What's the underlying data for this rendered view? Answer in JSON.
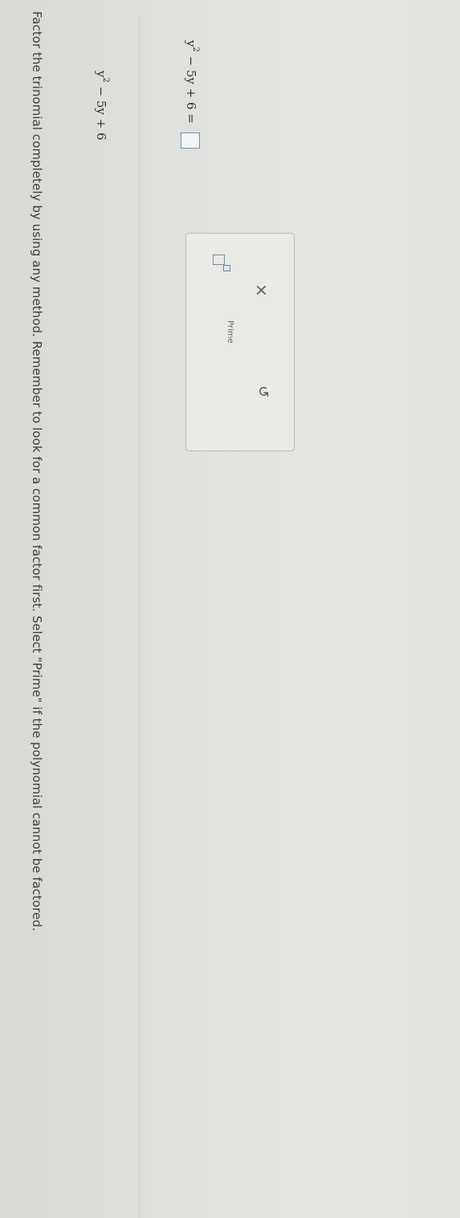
{
  "question": {
    "instructions": "Factor the trinomial completely by using any method. Remember to look for a common factor first. Select \"Prime\" if the polynomial cannot be factored.",
    "given_polynomial": {
      "base": "y",
      "exponent": "2",
      "rest": " − 5y + 6"
    },
    "answer_row": {
      "base": "y",
      "exponent": "2",
      "rest": " − 5y + 6 ="
    }
  },
  "keypad": {
    "exponent_icon": "exponent-template-icon",
    "prime_label": "Prime",
    "clear_glyph": "×",
    "undo_glyph": "↺"
  }
}
